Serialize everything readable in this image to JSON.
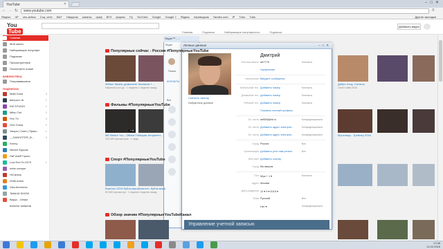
{
  "browser": {
    "tab_title": "YouTube",
    "url": "www.youtube.com",
    "bookmarks": [
      "Яндекс",
      "ЧР",
      "сео-кейсы",
      "Соц. сети",
      "WaT",
      "Накрутка",
      "каналы",
      "граф",
      "ВГН",
      "форекс",
      "Ру",
      "YouTube",
      "Google",
      "Google 7",
      "Яндекс",
      "переводчик",
      "Yandex.com",
      "IP",
      "Tubu",
      "Tubu",
      "Другие закладки"
    ]
  },
  "youtube": {
    "add_video_label": "Добавить видео",
    "nav": [
      "Главная",
      "Подписки",
      "Набирающие популярность",
      "Подписки"
    ],
    "sidebar": {
      "main_items": [
        {
          "label": "Главная",
          "count": "",
          "active": true
        },
        {
          "label": "Мой канал",
          "count": ""
        },
        {
          "label": "Набирающие популярн.",
          "count": ""
        },
        {
          "label": "Подписки",
          "count": ""
        },
        {
          "label": "Просмотренные",
          "count": ""
        },
        {
          "label": "Посмотреть позже",
          "count": ""
        }
      ],
      "library_title": "БИБЛИОТЕКА",
      "library_items": [
        {
          "label": "Понравившиеся"
        }
      ],
      "subs_title": "ПОДПИСКИ",
      "subs_items": [
        {
          "label": "Math Dvka",
          "count": "3"
        },
        {
          "label": "вепросч тв",
          "count": "1"
        },
        {
          "label": "KM STUDIO",
          "count": "1"
        },
        {
          "label": "Mitsu Turi",
          "count": "1"
        },
        {
          "label": "Fire TV",
          "count": "3"
        },
        {
          "label": "One China",
          "count": "2"
        },
        {
          "label": "Умора | Смех | Прико",
          "count": "1"
        },
        {
          "label": "__GANGSTER_B...",
          "count": "3"
        },
        {
          "label": "Kenny",
          "count": ""
        },
        {
          "label": "Nerizzi Ерусов",
          "count": ""
        },
        {
          "label": "НаГтАиФ Горыч",
          "count": ""
        },
        {
          "label": "Low End VLOG'S",
          "count": "1"
        },
        {
          "label": "nebe creeper",
          "count": ""
        },
        {
          "label": "HrCantos",
          "count": ""
        },
        {
          "label": "Zeffo Anton",
          "count": ""
        },
        {
          "label": "Vika Arechova",
          "count": ""
        },
        {
          "label": "Telikk18 SHOW",
          "count": ""
        },
        {
          "label": "Вирус - Отвал",
          "count": ""
        }
      ],
      "catalog": "Каталог каналов"
    },
    "sections": [
      {
        "title": "Популярные сейчас - Россия #ПопулярныеYouTube"
      },
      {
        "title": "Фильмы #ПопулярныеYouTube"
      },
      {
        "title": "Спорт #ПопулярныеYouTube"
      },
      {
        "title": "Обзор значим #ПопулярныеYouTubeКанал"
      }
    ],
    "videos": [
      {
        "title": "Фейка 'Жизнь дозволено'",
        "meta": "Научный угол.ру · 1 неделю назад",
        "dur": ""
      },
      {
        "title": "Малахов + ...",
        "meta": "1 неделю назад",
        "dur": ""
      },
      {
        "title": "Мистер Я...",
        "meta": "",
        "dur": ""
      },
      {
        "title": "Добро Хочу, Учитель",
        "meta": "Сингл тайм 2016",
        "dur": ""
      },
      {
        "title": "МЕ Before You - Official Trailer",
        "meta": "125 409 просмотров · 1 неделю назад",
        "dur": "2:58"
      },
      {
        "title": "Мария Антуанетт...",
        "meta": "",
        "dur": ""
      },
      {
        "title": "Мучелица - Трейлер 2016",
        "meta": "",
        "dur": ""
      },
      {
        "title": "Биатлон 2016 Кубок мира",
        "meta": "59 083 просмотра · 1 неделю назад",
        "dur": ""
      },
      {
        "title": "Биатлон. Кубок мира ...",
        "meta": "1 неделю назад",
        "dur": ""
      }
    ]
  },
  "skype": {
    "title": "Skype™ - ...",
    "menu": [
      "Skype",
      "Контакты",
      "Разговоры"
    ],
    "search_label": "Поиск",
    "contacts_label": "КОНТАКТЫ",
    "all_label": "Все",
    "favorites_label": "Избранные данные"
  },
  "profile": {
    "window_title": "Личные данные",
    "name": "Дмитрий",
    "change_avatar": "Сменить аватар",
    "favorites": "Избранные данные",
    "fields": [
      {
        "label": "Учетная запись",
        "value": "art7776",
        "right": "Контакты",
        "link": false
      },
      {
        "label": "",
        "value": "Управление",
        "right": "",
        "link": true
      },
      {
        "label": "Настроение",
        "value": "Введите сообщение",
        "right": "",
        "link": true
      },
      {
        "label": "Мобильный тел.",
        "value": "Добавить номер",
        "right": "Контакты",
        "link": true
      },
      {
        "label": "Домашний тел.",
        "value": "Добавить номер",
        "right": "Контакты",
        "link": true
      },
      {
        "label": "Рабочий тел.",
        "value": "Добавить номер",
        "right": "Контакты",
        "link": true
      },
      {
        "label": "",
        "value": "Показать полный профиль",
        "right": "",
        "link": true
      },
      {
        "label": "Эл. почта",
        "value": "art555@bk.ru",
        "right": "Конфиденциально",
        "link": false
      },
      {
        "label": "Эл. почта",
        "value": "Добавить адрес электрон...",
        "right": "Конфиденциально",
        "link": true
      },
      {
        "label": "Эл. почта",
        "value": "Добавить адрес электрон...",
        "right": "Конфиденциально",
        "link": true
      },
      {
        "label": "Город",
        "value": "Россия",
        "right": "Все",
        "link": false
      },
      {
        "label": "Организация",
        "value": "Добавить устн ним регион",
        "right": "Все",
        "link": true
      },
      {
        "label": "Веб-сайт",
        "value": "Добавить ссылку",
        "right": "",
        "link": true
      },
      {
        "label": "Город",
        "value": "Mo вашем",
        "right": "",
        "link": false
      },
      {
        "label": "Пол",
        "value": "Муж + 1 ▾",
        "right": "Контакты",
        "link": false
      },
      {
        "label": "Адрес",
        "value": "Москва",
        "right": "",
        "link": false
      },
      {
        "label": "Дата рождения",
        "value": "12 ▾  9 ▾  2015 ▾",
        "right": "",
        "link": false
      },
      {
        "label": "Язык",
        "value": "Русский",
        "right": "Все",
        "link": false
      },
      {
        "label": "",
        "value": "Нет ▾",
        "right": "Конфиденциально",
        "link": false
      }
    ],
    "footer": "Управление учетной записью"
  },
  "taskbar": {
    "time": "17:08",
    "date": "11.02.2016"
  }
}
